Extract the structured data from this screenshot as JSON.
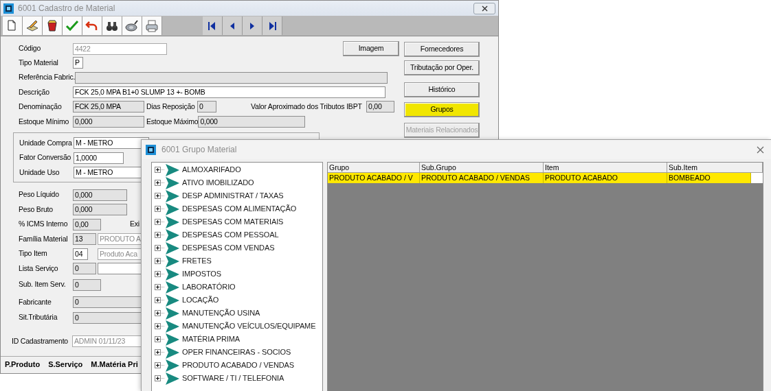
{
  "main_window": {
    "title": "6001 Cadastro de Material"
  },
  "form": {
    "top_rows": [
      [
        {
          "kind": "label",
          "text": "Código"
        },
        {
          "kind": "field",
          "read_only": false,
          "disabled": true,
          "value": "4422"
        }
      ],
      [
        {
          "kind": "label",
          "text": "Tipo Material"
        },
        {
          "kind": "field",
          "read_only": false,
          "disabled": false,
          "value": "P"
        }
      ],
      [
        {
          "kind": "label",
          "text": "Referência Fabric."
        },
        {
          "kind": "field",
          "read_only": true,
          "disabled": false
        }
      ],
      [
        {
          "kind": "label",
          "text": "Descrição"
        },
        {
          "kind": "field",
          "read_only": false,
          "disabled": false,
          "value": "FCK 25,0 MPA B1+0 SLUMP 13 +- BOMB"
        }
      ],
      [
        {
          "kind": "label",
          "text": "Denominação"
        },
        {
          "kind": "field",
          "read_only": true,
          "disabled": false,
          "value": "FCK 25,0 MPA"
        },
        {
          "kind": "label",
          "text": "Dias Reposição"
        },
        {
          "kind": "field",
          "read_only": true,
          "disabled": false,
          "value": "0"
        },
        {
          "kind": "label",
          "text": "Valor Aproximado dos Tributos IBPT"
        },
        {
          "kind": "field",
          "read_only": true,
          "disabled": false,
          "value": "0,00"
        }
      ],
      [
        {
          "kind": "label",
          "text": "Estoque Mínimo"
        },
        {
          "kind": "field",
          "read_only": true,
          "disabled": false,
          "value": "0,000"
        },
        {
          "kind": "label",
          "text": "Estoque Máximo"
        },
        {
          "kind": "field",
          "read_only": true,
          "disabled": false,
          "value": "0,000"
        }
      ]
    ],
    "unit_rows": [
      [
        {
          "kind": "label",
          "text": "Unidade Compra"
        },
        {
          "kind": "field",
          "read_only": false,
          "disabled": false,
          "value": "M - METRO"
        }
      ],
      [
        {
          "kind": "label",
          "text": "Fator Conversão"
        },
        {
          "kind": "field",
          "read_only": false,
          "disabled": false,
          "value": "1,0000"
        }
      ],
      [
        {
          "kind": "label",
          "text": "Unidade Uso"
        },
        {
          "kind": "field",
          "read_only": false,
          "disabled": false,
          "value": "M - METRO"
        }
      ]
    ],
    "lower_rows": [
      [
        {
          "kind": "label",
          "text": "Peso Líquido"
        },
        {
          "kind": "field",
          "read_only": true,
          "disabled": false,
          "value": "0,000"
        }
      ],
      [
        {
          "kind": "label",
          "text": "Peso Bruto"
        },
        {
          "kind": "field",
          "read_only": true,
          "disabled": false,
          "value": "0,000"
        }
      ],
      [
        {
          "kind": "label",
          "text": "% ICMS Interno"
        },
        {
          "kind": "field",
          "read_only": true,
          "disabled": false,
          "value": "0,00"
        },
        {
          "kind": "label",
          "text": "Exi"
        }
      ],
      [
        {
          "kind": "label",
          "text": "Família Material"
        },
        {
          "kind": "field",
          "read_only": true,
          "disabled": false,
          "value": "13"
        },
        {
          "kind": "field",
          "read_only": false,
          "disabled": true,
          "value": "PRODUTO A"
        }
      ],
      [
        {
          "kind": "label",
          "text": "Tipo Item"
        },
        {
          "kind": "field",
          "read_only": false,
          "disabled": false,
          "value": "04"
        },
        {
          "kind": "field",
          "read_only": false,
          "disabled": true,
          "value": "Produto Aca"
        }
      ],
      [
        {
          "kind": "label",
          "text": "Lista Serviço"
        },
        {
          "kind": "field",
          "read_only": true,
          "disabled": false,
          "value": "0"
        },
        {
          "kind": "field",
          "read_only": false,
          "disabled": false
        }
      ],
      [
        {
          "kind": "label",
          "text": "Sub. Item Serv."
        },
        {
          "kind": "field",
          "read_only": true,
          "disabled": false,
          "value": "0"
        }
      ],
      [
        {
          "kind": "label",
          "text": "Fabricante"
        },
        {
          "kind": "field",
          "read_only": true,
          "disabled": false,
          "value": "0"
        }
      ],
      [
        {
          "kind": "label",
          "text": "Sit.Tributária"
        },
        {
          "kind": "field",
          "read_only": true,
          "disabled": false,
          "value": "0"
        }
      ],
      [
        {
          "kind": "label",
          "text": "ID Cadastramento"
        },
        {
          "kind": "field",
          "read_only": false,
          "disabled": true,
          "value": "ADMIN 01/11/23"
        }
      ]
    ]
  },
  "image_button": {
    "label": "Imagem"
  },
  "side_buttons": [
    {
      "label": "Fornecedores",
      "disabled": false,
      "highlighted": false
    },
    {
      "label": "Tributação por Oper.",
      "disabled": false,
      "highlighted": false
    },
    {
      "label": "Histórico",
      "disabled": false,
      "highlighted": false
    },
    {
      "label": "Grupos",
      "disabled": false,
      "highlighted": true
    },
    {
      "label": "Materiais Relacionados",
      "disabled": true,
      "highlighted": false
    }
  ],
  "status_bar": [
    "P.Produto",
    "S.Serviço",
    "M.Matéria Pri"
  ],
  "dialog": {
    "title": "6001 Grupo Material",
    "tree": [
      {
        "label": "ALMOXARIFADO",
        "expanded": false
      },
      {
        "label": "ATIVO IMOBILIZADO",
        "expanded": false
      },
      {
        "label": "DESP ADMINISTRAT / TAXAS",
        "expanded": false
      },
      {
        "label": "DESPESAS COM ALIMENTAÇÃO",
        "expanded": false
      },
      {
        "label": "DESPESAS COM MATERIAIS",
        "expanded": false
      },
      {
        "label": "DESPESAS COM PESSOAL",
        "expanded": false
      },
      {
        "label": "DESPESAS COM VENDAS",
        "expanded": false
      },
      {
        "label": "FRETES",
        "expanded": false
      },
      {
        "label": "IMPOSTOS",
        "expanded": false
      },
      {
        "label": "LABORATÓRIO",
        "expanded": false
      },
      {
        "label": "LOCAÇÃO",
        "expanded": false
      },
      {
        "label": "MANUTENÇÃO USINA",
        "expanded": false
      },
      {
        "label": "MANUTENÇÃO VEÍCULOS/EQUIPAME",
        "expanded": false
      },
      {
        "label": "MATÉRIA PRIMA",
        "expanded": false
      },
      {
        "label": "OPER FINANCEIRAS - SOCIOS",
        "expanded": false
      },
      {
        "label": "PRODUTO ACABADO / VENDAS",
        "expanded": false
      },
      {
        "label": "SOFTWARE / TI / TELEFONIA",
        "expanded": false
      }
    ],
    "table": {
      "columns": [
        "Grupo",
        "Sub.Grupo",
        "Item",
        "Sub.Item"
      ],
      "rows": [
        {
          "cells": [
            "PRODUTO ACABADO / V",
            "PRODUTO ACABADO / VENDAS",
            "PRODUTO ACABADO",
            "BOMBEADO"
          ],
          "selected": true
        }
      ]
    }
  }
}
